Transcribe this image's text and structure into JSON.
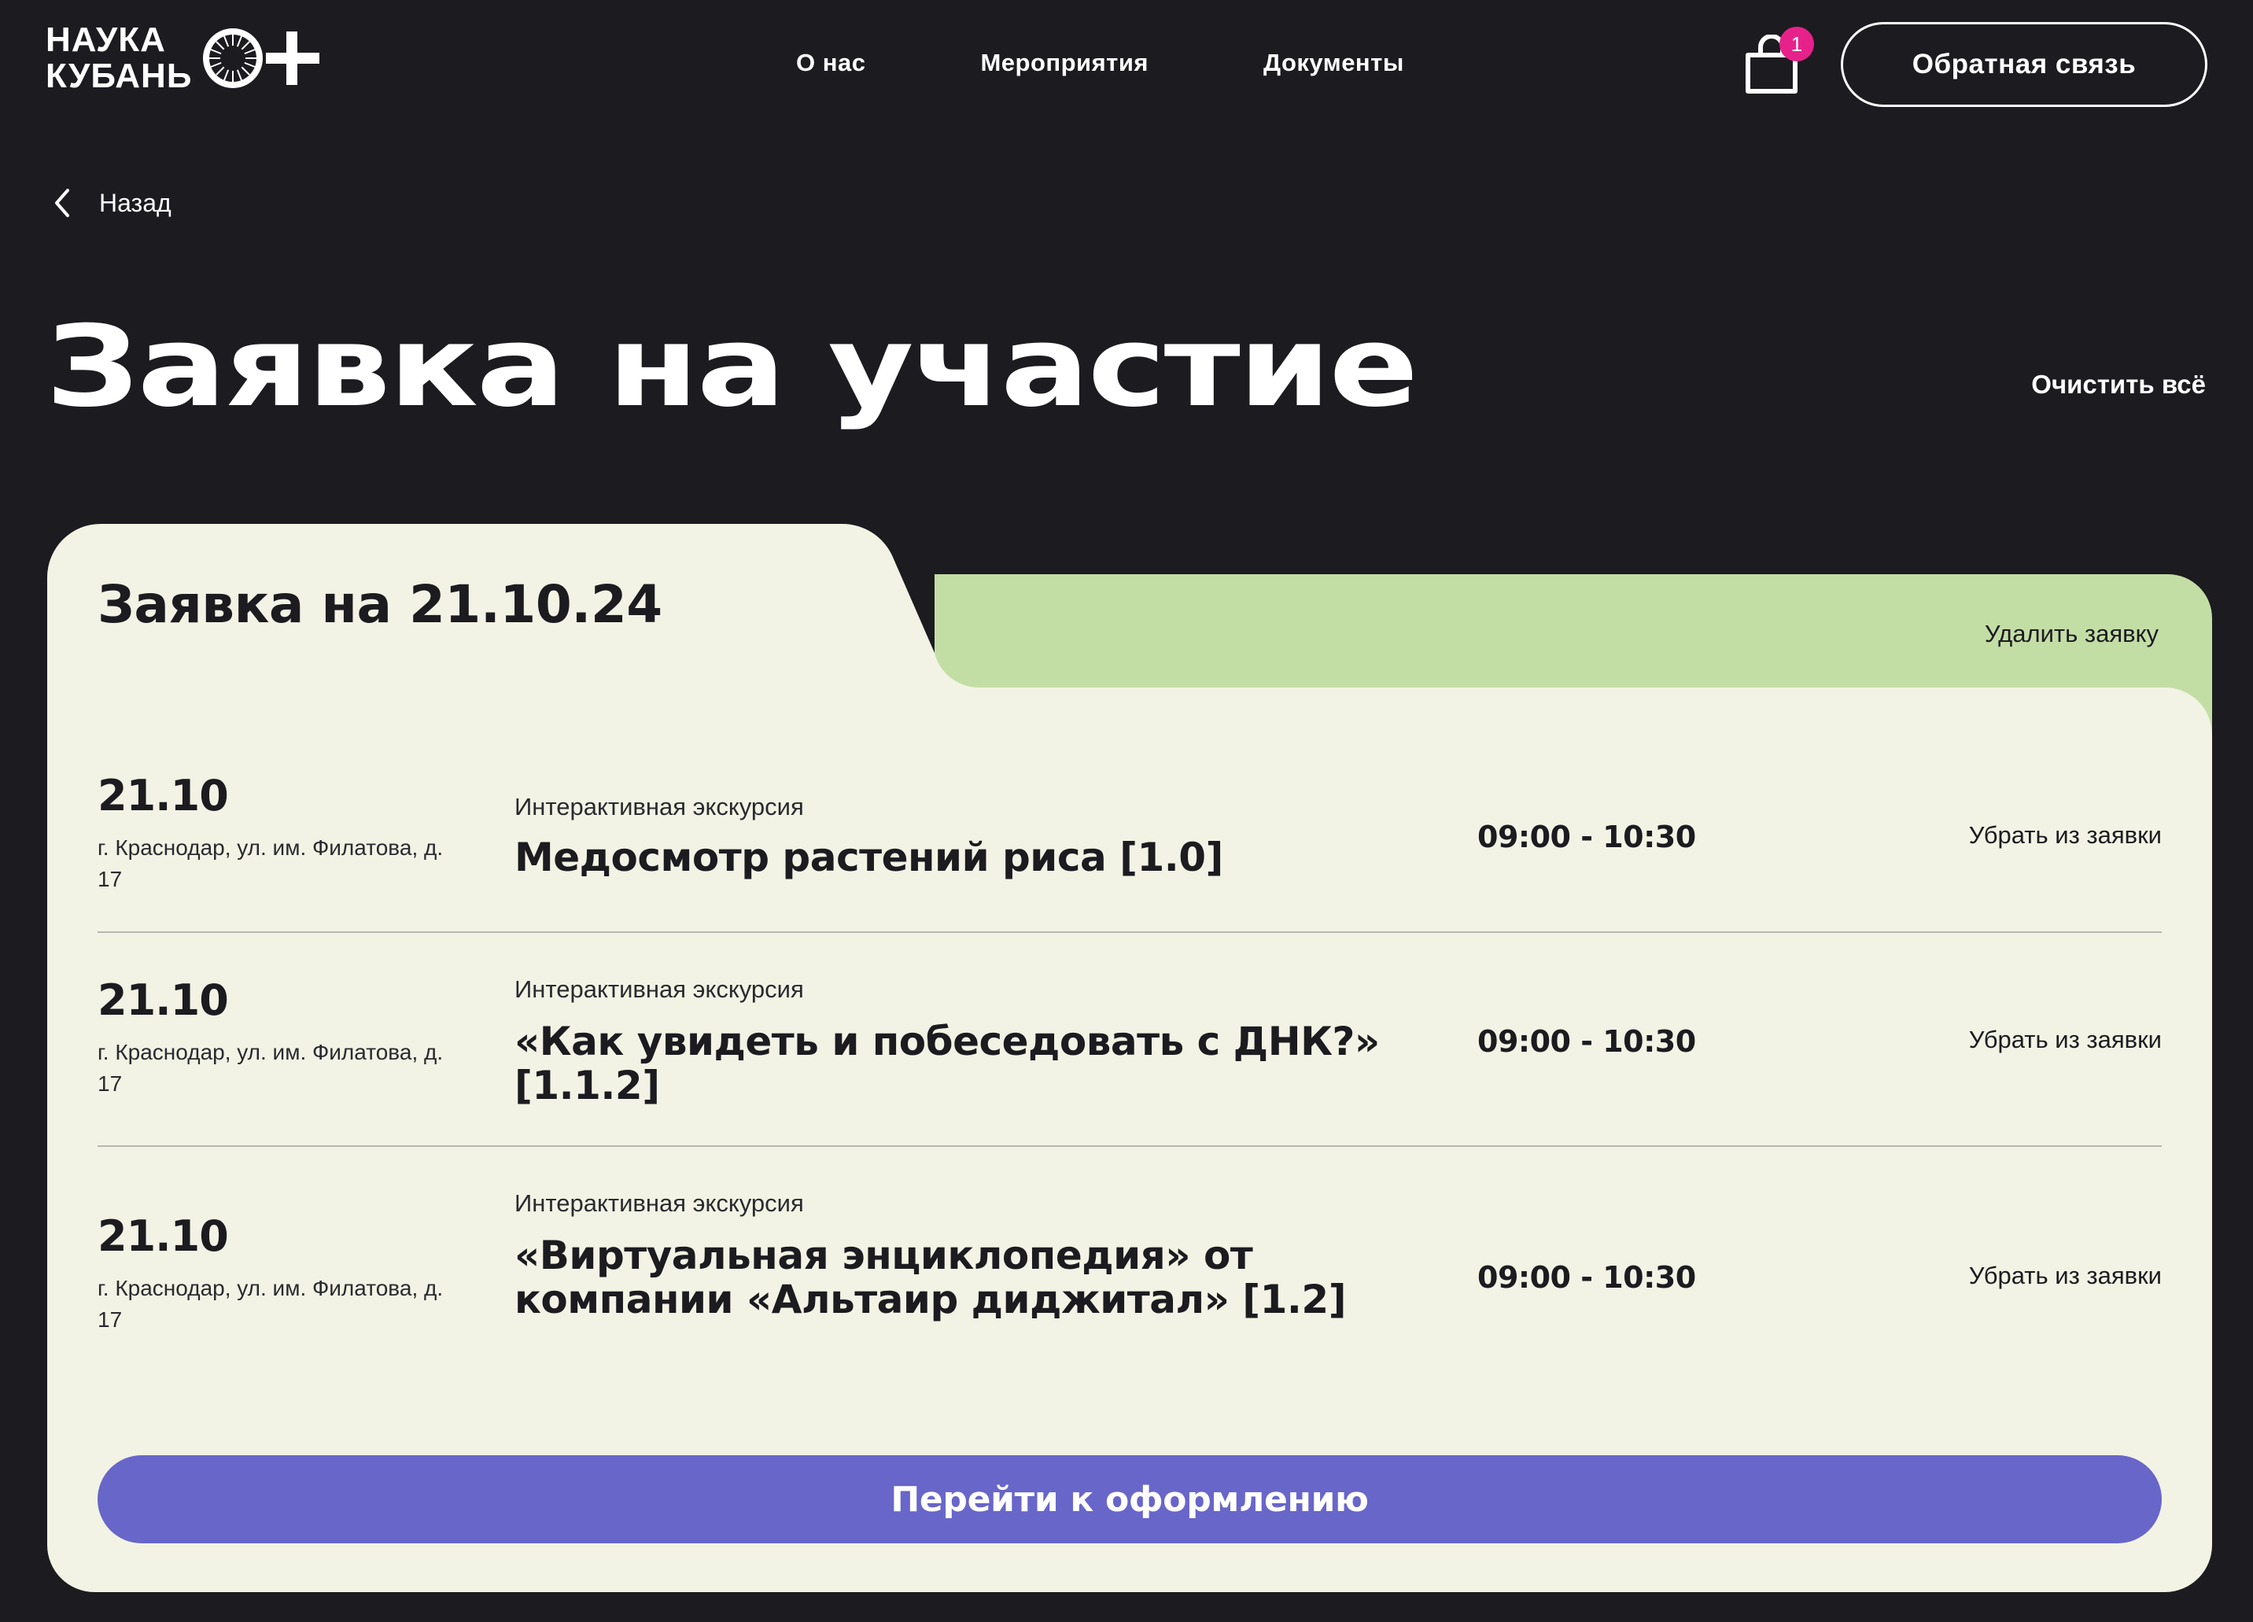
{
  "header": {
    "logo_line1": "НАУКА",
    "logo_line2": "КУБАНЬ",
    "nav": [
      "О нас",
      "Мероприятия",
      "Документы"
    ],
    "cart_count": "1",
    "feedback_label": "Обратная связь"
  },
  "back_label": "Назад",
  "page_title": "Заявка на участие",
  "clear_all_label": "Очистить всё",
  "request": {
    "title": "Заявка на 21.10.24",
    "delete_label": "Удалить заявку",
    "items": [
      {
        "date": "21.10",
        "address": "г. Краснодар, ул. им. Филатова, д. 17",
        "type": "Интерактивная экскурсия",
        "title": "Медосмотр растений риса [1.0]",
        "time": "09:00 - 10:30",
        "remove_label": "Убрать из заявки"
      },
      {
        "date": "21.10",
        "address": "г. Краснодар, ул. им. Филатова, д. 17",
        "type": "Интерактивная экскурсия",
        "title": "«Как увидеть и побеседовать  с ДНК?» [1.1.2]",
        "time": "09:00 - 10:30",
        "remove_label": "Убрать из заявки"
      },
      {
        "date": "21.10",
        "address": "г. Краснодар, ул. им. Филатова, д. 17",
        "type": "Интерактивная экскурсия",
        "title": "«Виртуальная энциклопедия» от компании «Альтаир диджитал» [1.2]",
        "time": "09:00 - 10:30",
        "remove_label": "Убрать из заявки"
      }
    ],
    "checkout_label": "Перейти к оформлению"
  },
  "colors": {
    "background": "#1c1b20",
    "card": "#f2f3e4",
    "tab_green": "#c3dea5",
    "accent_button": "#6866c9",
    "badge": "#e6228a"
  }
}
